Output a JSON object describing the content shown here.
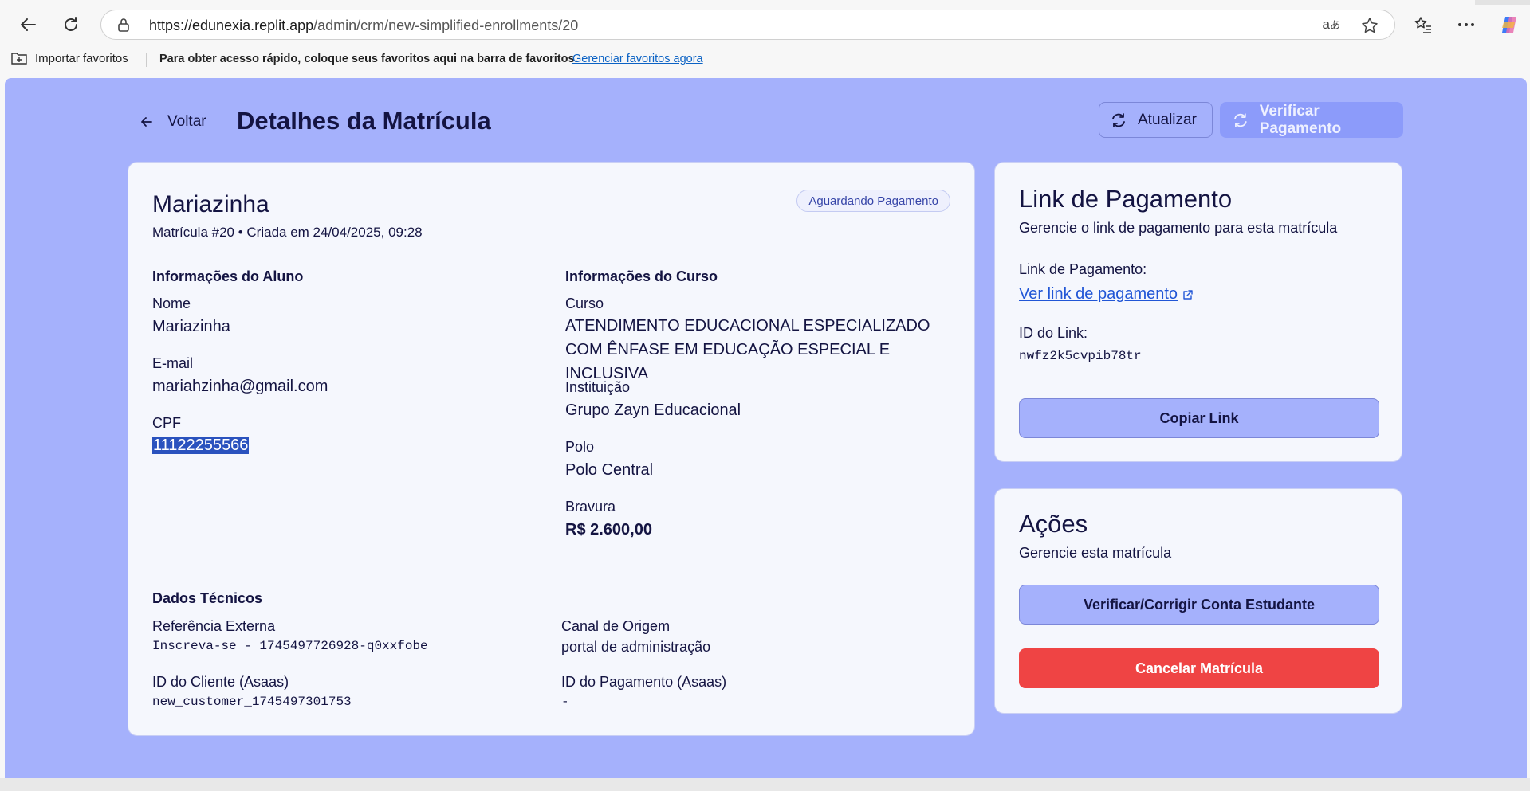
{
  "browser": {
    "url_host": "https://edunexia.replit.app",
    "url_path": "/admin/crm/new-simplified-enrollments/20",
    "favorites": {
      "import_label": "Importar favoritos",
      "tip": "Para obter acesso rápido, coloque seus favoritos aqui na barra de favoritos.",
      "manage_link": "Gerenciar favoritos agora"
    }
  },
  "header": {
    "back_label": "Voltar",
    "title": "Detalhes da Matrícula",
    "refresh_label": "Atualizar",
    "verify_payment_label": "Verificar Pagamento"
  },
  "enrollment": {
    "student_name": "Mariazinha",
    "status": "Aguardando Pagamento",
    "subtitle": "Matrícula #20 • Criada em 24/04/2025, 09:28",
    "student_section": {
      "title": "Informações do Aluno",
      "name_label": "Nome",
      "name": "Mariazinha",
      "email_label": "E-mail",
      "email": "mariahzinha@gmail.com",
      "cpf_label": "CPF",
      "cpf": "11122255566"
    },
    "course_section": {
      "title": "Informações do Curso",
      "course_label": "Curso",
      "course": "ATENDIMENTO EDUCACIONAL ESPECIALIZADO COM ÊNFASE EM EDUCAÇÃO ESPECIAL E INCLUSIVA",
      "institution_label": "Instituição",
      "institution": "Grupo Zayn Educacional",
      "polo_label": "Polo",
      "polo": "Polo Central",
      "value_label": "Bravura",
      "value": "R$ 2.600,00"
    },
    "technical": {
      "title": "Dados Técnicos",
      "ext_ref_label": "Referência Externa",
      "ext_ref": "Inscreva-se - 1745497726928-q0xxfobe",
      "channel_label": "Canal de Origem",
      "channel": "portal de administração",
      "client_id_label": "ID do Cliente (Asaas)",
      "client_id": "new_customer_1745497301753",
      "payment_id_label": "ID do Pagamento (Asaas)",
      "payment_id": "-"
    }
  },
  "payment_card": {
    "title": "Link de Pagamento",
    "description": "Gerencie o link de pagamento para esta matrícula",
    "link_label": "Link de Pagamento:",
    "link_text": "Ver link de pagamento",
    "id_label": "ID do Link:",
    "id_value": "nwfz2k5cvpib78tr",
    "copy_label": "Copiar Link"
  },
  "actions_card": {
    "title": "Ações",
    "description": "Gerencie esta matrícula",
    "verify_account_label": "Verificar/Corrigir Conta Estudante",
    "cancel_label": "Cancelar Matrícula"
  },
  "colors": {
    "background": "#a5b1fc",
    "card": "#f5f7fd",
    "danger": "#ef4444",
    "link": "#2156d6"
  }
}
